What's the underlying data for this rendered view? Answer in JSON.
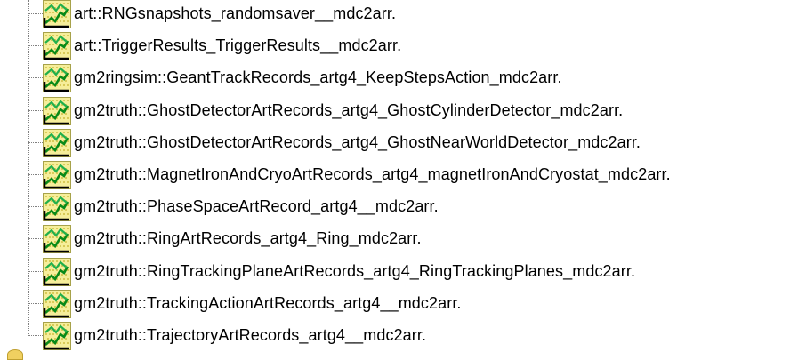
{
  "tree": {
    "items": [
      {
        "label": "art::RNGsnapshots_randomsaver__mdc2arr.",
        "icon": "leaf-histogram-icon"
      },
      {
        "label": "art::TriggerResults_TriggerResults__mdc2arr.",
        "icon": "leaf-histogram-icon"
      },
      {
        "label": "gm2ringsim::GeantTrackRecords_artg4_KeepStepsAction_mdc2arr.",
        "icon": "leaf-histogram-icon"
      },
      {
        "label": "gm2truth::GhostDetectorArtRecords_artg4_GhostCylinderDetector_mdc2arr.",
        "icon": "leaf-histogram-icon"
      },
      {
        "label": "gm2truth::GhostDetectorArtRecords_artg4_GhostNearWorldDetector_mdc2arr.",
        "icon": "leaf-histogram-icon"
      },
      {
        "label": "gm2truth::MagnetIronAndCryoArtRecords_artg4_magnetIronAndCryostat_mdc2arr.",
        "icon": "leaf-histogram-icon"
      },
      {
        "label": "gm2truth::PhaseSpaceArtRecord_artg4__mdc2arr.",
        "icon": "leaf-histogram-icon"
      },
      {
        "label": "gm2truth::RingArtRecords_artg4_Ring_mdc2arr.",
        "icon": "leaf-histogram-icon"
      },
      {
        "label": "gm2truth::RingTrackingPlaneArtRecords_artg4_RingTrackingPlanes_mdc2arr.",
        "icon": "leaf-histogram-icon"
      },
      {
        "label": "gm2truth::TrackingActionArtRecords_artg4__mdc2arr.",
        "icon": "leaf-histogram-icon"
      },
      {
        "label": "gm2truth::TrajectoryArtRecords_artg4__mdc2arr.",
        "icon": "leaf-histogram-icon"
      }
    ]
  }
}
